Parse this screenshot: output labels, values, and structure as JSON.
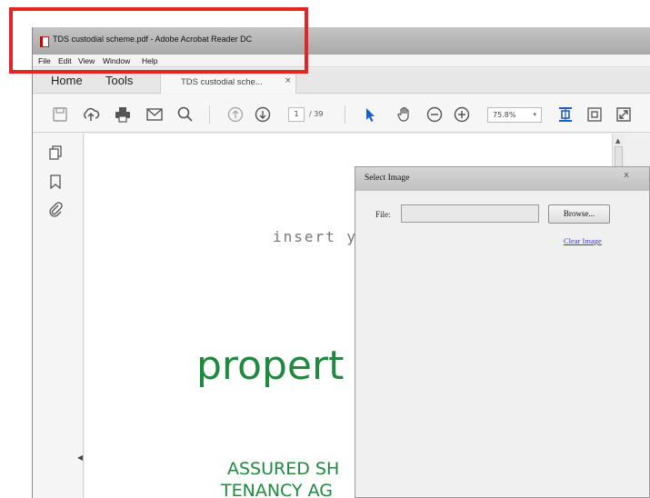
{
  "window": {
    "title": "TDS custodial scheme.pdf - Adobe Acrobat Reader DC"
  },
  "menu": {
    "items": [
      "File",
      "Edit",
      "View",
      "Window",
      "Help"
    ]
  },
  "tabs": {
    "home": "Home",
    "tools": "Tools",
    "document": "TDS custodial sche...",
    "document_close": "×"
  },
  "toolbar": {
    "icons": [
      "save-icon",
      "upload-icon",
      "print-icon",
      "email-icon",
      "search-icon",
      "previous-page-icon",
      "next-page-icon",
      "select-cursor-icon",
      "hand-icon",
      "zoom-out-icon",
      "zoom-in-icon",
      "fit-page-icon",
      "rotate-icon",
      "full-screen-icon"
    ],
    "page_current": "1",
    "page_total": "/ 39",
    "zoom": "75.8%",
    "zoom_arrow": "▾"
  },
  "sidebar": {
    "icons": [
      "pages-icon",
      "bookmark-icon",
      "attachment-icon"
    ],
    "collapse_arrow": "◀"
  },
  "document": {
    "insert_text": "insert yo",
    "property_text": "propert",
    "assured_text": "ASSURED SH",
    "tenancy_text": "TENANCY AG"
  },
  "scrollbar": {
    "up_arrow": "▲"
  },
  "dialog": {
    "title": "Select Image",
    "close": "x",
    "file_label": "File:",
    "file_value": "",
    "browse_label": "Browse...",
    "clear_label": "Clear Image"
  },
  "colors": {
    "highlight": "#e22626",
    "brand_green": "#1e8a3e",
    "acrobat_red": "#cc0000",
    "link": "#3a3ad0",
    "active_tool": "#1a5fcc"
  }
}
